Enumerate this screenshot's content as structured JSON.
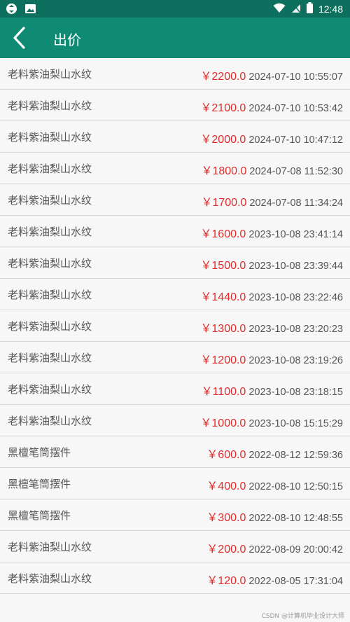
{
  "status": {
    "time": "12:48"
  },
  "toolbar": {
    "title": "出价"
  },
  "bids": [
    {
      "name": "老料紫油梨山水纹",
      "price": "￥2200.0",
      "time": "2024-07-10 10:55:07"
    },
    {
      "name": "老料紫油梨山水纹",
      "price": "￥2100.0",
      "time": "2024-07-10 10:53:42"
    },
    {
      "name": "老料紫油梨山水纹",
      "price": "￥2000.0",
      "time": "2024-07-10 10:47:12"
    },
    {
      "name": "老料紫油梨山水纹",
      "price": "￥1800.0",
      "time": "2024-07-08 11:52:30"
    },
    {
      "name": "老料紫油梨山水纹",
      "price": "￥1700.0",
      "time": "2024-07-08 11:34:24"
    },
    {
      "name": "老料紫油梨山水纹",
      "price": "￥1600.0",
      "time": "2023-10-08 23:41:14"
    },
    {
      "name": "老料紫油梨山水纹",
      "price": "￥1500.0",
      "time": "2023-10-08 23:39:44"
    },
    {
      "name": "老料紫油梨山水纹",
      "price": "￥1440.0",
      "time": "2023-10-08 23:22:46"
    },
    {
      "name": "老料紫油梨山水纹",
      "price": "￥1300.0",
      "time": "2023-10-08 23:20:23"
    },
    {
      "name": "老料紫油梨山水纹",
      "price": "￥1200.0",
      "time": "2023-10-08 23:19:26"
    },
    {
      "name": "老料紫油梨山水纹",
      "price": "￥1100.0",
      "time": "2023-10-08 23:18:15"
    },
    {
      "name": "老料紫油梨山水纹",
      "price": "￥1000.0",
      "time": "2023-10-08 15:15:29"
    },
    {
      "name": "黑檀笔筒摆件",
      "price": "￥600.0",
      "time": "2022-08-12 12:59:36"
    },
    {
      "name": "黑檀笔筒摆件",
      "price": "￥400.0",
      "time": "2022-08-10 12:50:15"
    },
    {
      "name": "黑檀笔筒摆件",
      "price": "￥300.0",
      "time": "2022-08-10 12:48:55"
    },
    {
      "name": "老料紫油梨山水纹",
      "price": "￥200.0",
      "time": "2022-08-09 20:00:42"
    },
    {
      "name": "老料紫油梨山水纹",
      "price": "￥120.0",
      "time": "2022-08-05 17:31:04"
    }
  ],
  "watermark": "CSDN @计算机毕业设计大师",
  "colors": {
    "statusbar": "#0d6f5e",
    "toolbar": "#0f8a73",
    "price": "#e12b2b"
  }
}
